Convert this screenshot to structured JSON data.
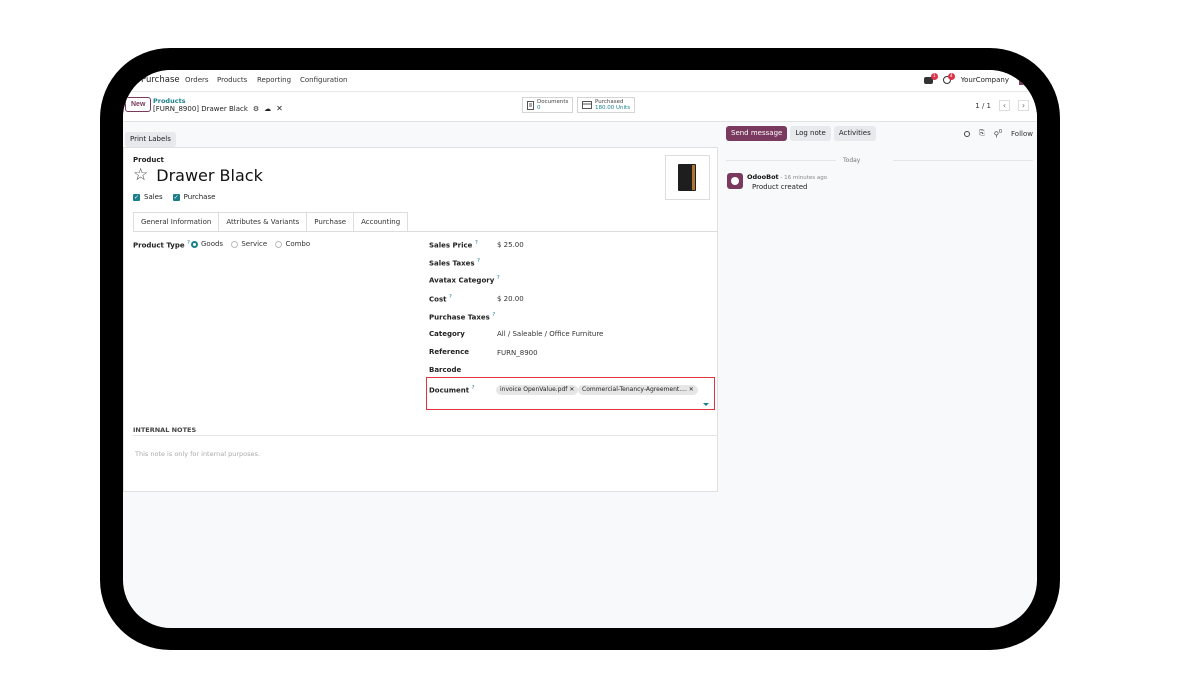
{
  "topbar": {
    "app_name": "Purchase",
    "nav": [
      "Orders",
      "Products",
      "Reporting",
      "Configuration"
    ],
    "messages_badge": "1",
    "activities_badge": "4",
    "company": "YourCompany"
  },
  "control": {
    "new_label": "New",
    "breadcrumb_parent": "Products",
    "breadcrumb_current": "[FURN_8900] Drawer Black",
    "documents_label": "Documents",
    "documents_count": "0",
    "purchased_label": "Purchased",
    "purchased_value": "180.00 Units",
    "pager": "1 / 1"
  },
  "actions": {
    "print_labels": "Print Labels"
  },
  "product": {
    "label": "Product",
    "name": "Drawer Black",
    "sales_label": "Sales",
    "purchase_label": "Purchase"
  },
  "tabs": [
    "General Information",
    "Attributes & Variants",
    "Purchase",
    "Accounting"
  ],
  "general": {
    "product_type_label": "Product Type",
    "product_type_options": [
      "Goods",
      "Service",
      "Combo"
    ],
    "sales_price_label": "Sales Price",
    "sales_price": "$ 25.00",
    "sales_taxes_label": "Sales Taxes",
    "avatax_label": "Avatax Category",
    "cost_label": "Cost",
    "cost": "$ 20.00",
    "purchase_taxes_label": "Purchase Taxes",
    "category_label": "Category",
    "category": "All / Saleable / Office Furniture",
    "reference_label": "Reference",
    "reference": "FURN_8900",
    "barcode_label": "Barcode",
    "document_label": "Document",
    "document_tags": [
      "invoice OpenValue.pdf",
      "Commercial-Tenancy-Agreement...."
    ]
  },
  "notes": {
    "title": "INTERNAL NOTES",
    "placeholder": "This note is only for internal purposes."
  },
  "chatter": {
    "send_message": "Send message",
    "log_note": "Log note",
    "activities": "Activities",
    "followers_count": "0",
    "follow": "Follow",
    "today": "Today",
    "author": "OdooBot",
    "time": " - 16 minutes ago",
    "body": "Product created"
  },
  "colors": {
    "brand": "#7a3a5f",
    "accent": "#1a7f8a",
    "highlight": "#e0333b"
  }
}
